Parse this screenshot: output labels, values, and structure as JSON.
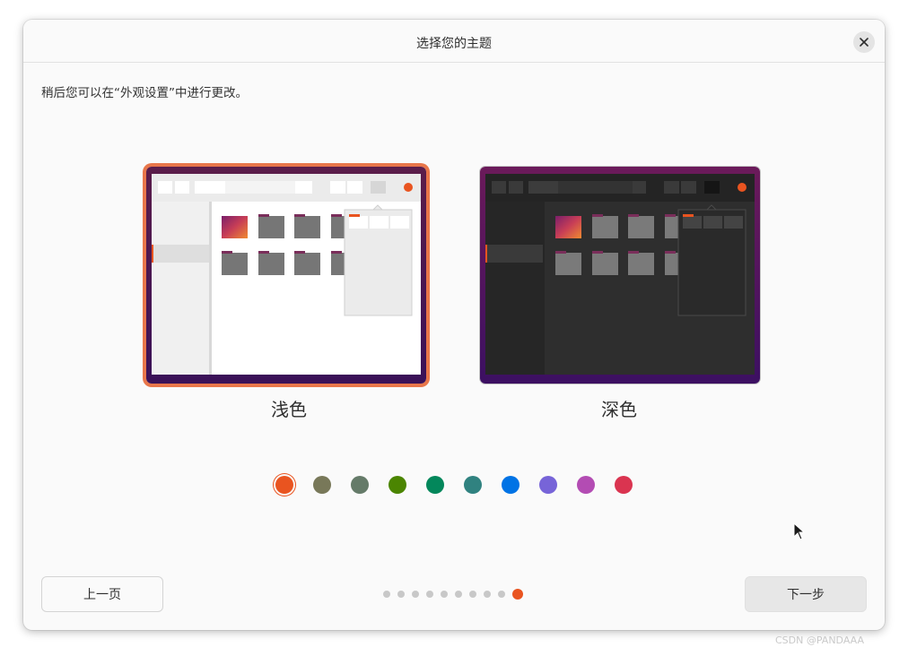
{
  "window": {
    "title": "选择您的主题"
  },
  "subtitle": "稍后您可以在“外观设置”中进行更改。",
  "themes": [
    {
      "label": "浅色",
      "selected": true
    },
    {
      "label": "深色",
      "selected": false
    }
  ],
  "accent_colors": [
    {
      "name": "orange",
      "hex": "#e95420",
      "selected": true
    },
    {
      "name": "bark",
      "hex": "#787859"
    },
    {
      "name": "sage",
      "hex": "#657b69"
    },
    {
      "name": "olive",
      "hex": "#4b8501"
    },
    {
      "name": "viridian",
      "hex": "#03875b"
    },
    {
      "name": "prussian-green",
      "hex": "#308280"
    },
    {
      "name": "blue",
      "hex": "#0073e5"
    },
    {
      "name": "purple",
      "hex": "#7764d8"
    },
    {
      "name": "magenta",
      "hex": "#b34cb3"
    },
    {
      "name": "red",
      "hex": "#da3450"
    }
  ],
  "navigation": {
    "back_label": "上一页",
    "next_label": "下一步"
  },
  "progress": {
    "total_steps": 10,
    "current_step": 10
  },
  "watermark": "CSDN @PANDAAA"
}
